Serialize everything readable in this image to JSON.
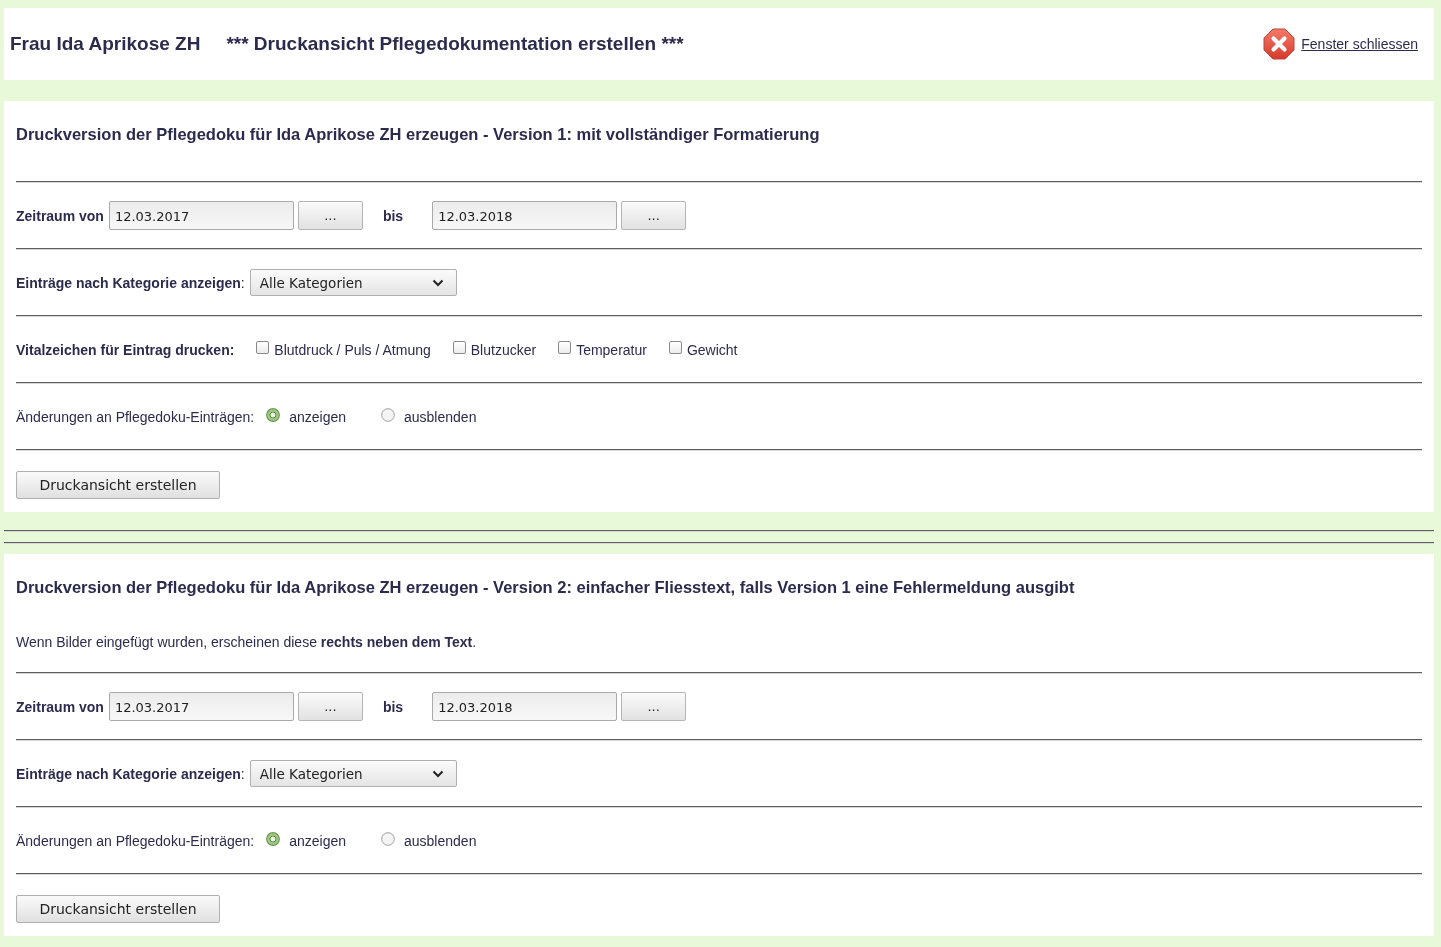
{
  "header": {
    "patient": "Frau Ida Aprikose ZH",
    "title": "*** Druckansicht Pflegedokumentation erstellen ***",
    "close_link": "Fenster schliessen"
  },
  "sections": [
    {
      "title": "Druckversion der Pflegedoku für Ida Aprikose ZH erzeugen - Version 1: mit vollständiger Formatierung",
      "rows": [
        {
          "kind": "date_range",
          "label": "Zeitraum von",
          "from": "12.03.2017",
          "from_button": "...",
          "to_label": "bis",
          "to": "12.03.2018",
          "to_button": "..."
        },
        {
          "kind": "select",
          "label": "**Einträge nach Kategorie anzeigen**:",
          "value": "Alle Kategorien"
        },
        {
          "kind": "checkboxes",
          "label": "Vitalzeichen für Eintrag drucken:",
          "options": [
            {
              "label": "Blutdruck / Puls / Atmung",
              "checked": false
            },
            {
              "label": "Blutzucker",
              "checked": false
            },
            {
              "label": "Temperatur",
              "checked": false
            },
            {
              "label": "Gewicht",
              "checked": false
            }
          ]
        },
        {
          "kind": "radios",
          "label": "Änderungen an Pflegedoku-Einträgen:",
          "options": [
            {
              "label": "anzeigen",
              "selected": true
            },
            {
              "label": "ausblenden",
              "selected": false
            }
          ]
        }
      ],
      "submit": "Druckansicht erstellen"
    },
    {
      "title": "Druckversion der Pflegedoku für Ida Aprikose ZH erzeugen - Version 2: einfacher Fliesstext, falls Version 1 eine Fehlermeldung ausgibt",
      "note": "Wenn Bilder eingefügt wurden, erscheinen diese **rechts neben dem Text**.",
      "rows": [
        {
          "kind": "date_range",
          "label": "Zeitraum von",
          "from": "12.03.2017",
          "from_button": "...",
          "to_label": "bis",
          "to": "12.03.2018",
          "to_button": "..."
        },
        {
          "kind": "select",
          "label": "**Einträge nach Kategorie anzeigen**:",
          "value": "Alle Kategorien"
        },
        {
          "kind": "radios",
          "label": "Änderungen an Pflegedoku-Einträgen:",
          "options": [
            {
              "label": "anzeigen",
              "selected": true
            },
            {
              "label": "ausblenden",
              "selected": false
            }
          ]
        }
      ],
      "submit": "Druckansicht erstellen"
    }
  ]
}
